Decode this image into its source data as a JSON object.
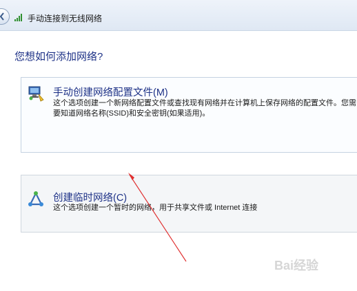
{
  "window": {
    "title": "手动连接到无线网络"
  },
  "question": "您想如何添加网络?",
  "options": [
    {
      "title": "手动创建网络配置文件(M)",
      "description": "这个选项创建一个新网络配置文件或查找现有网络并在计算机上保存网络的配置文件。您需要知道网络名称(SSID)和安全密钥(如果适用)。",
      "icon": "network-computer-icon"
    },
    {
      "title": "创建临时网络(C)",
      "description": "这个选项创建一个暂时的网络，用于共享文件或 Internet 连接",
      "icon": "adhoc-network-icon"
    }
  ],
  "annotation": {
    "arrow_color": "#e03030"
  },
  "watermark": "Bai经验"
}
